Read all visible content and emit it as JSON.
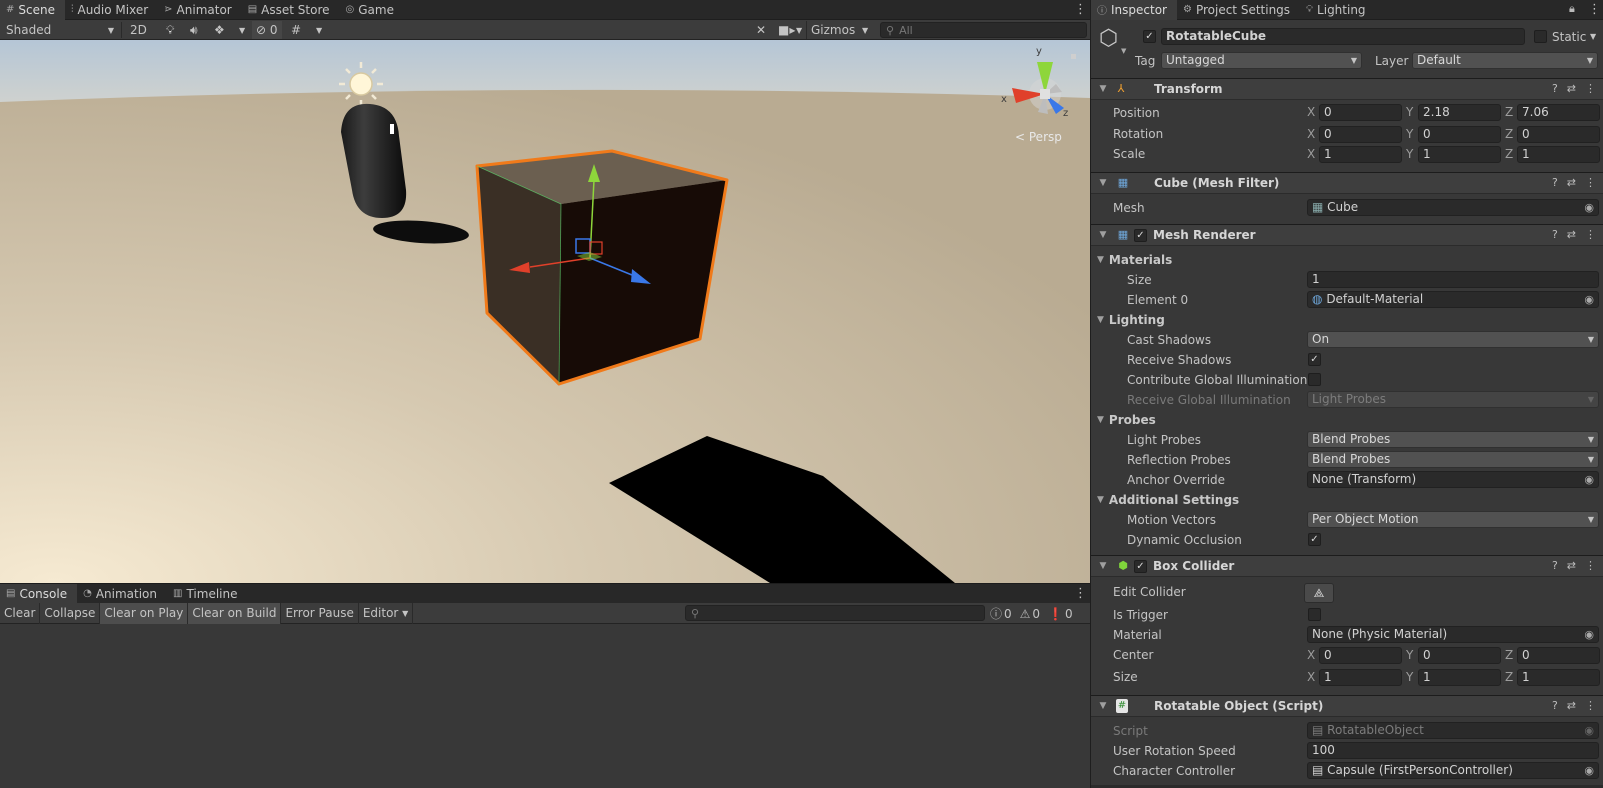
{
  "scene_window": {
    "tabs": [
      {
        "label": "Scene",
        "icon": "hash-icon"
      },
      {
        "label": "Audio Mixer",
        "icon": "mixer-icon"
      },
      {
        "label": "Animator",
        "icon": "animator-icon"
      },
      {
        "label": "Asset Store",
        "icon": "store-icon"
      },
      {
        "label": "Game",
        "icon": "gamepad-icon"
      }
    ],
    "toolbar": {
      "draw_mode": "Shaded",
      "mode_2d": "2D",
      "hidden_count": "0",
      "gizmos_label": "Gizmos",
      "search_placeholder": "All"
    },
    "persp_label": "Persp",
    "axis_labels": {
      "x": "x",
      "y": "y",
      "z": "z"
    }
  },
  "console_window": {
    "tabs": [
      {
        "label": "Console",
        "icon": "console-icon"
      },
      {
        "label": "Animation",
        "icon": "animation-icon"
      },
      {
        "label": "Timeline",
        "icon": "timeline-icon"
      }
    ],
    "buttons": [
      "Clear",
      "Collapse",
      "Clear on Play",
      "Clear on Build",
      "Error Pause",
      "Editor"
    ],
    "counts": {
      "info": "0",
      "warnings": "0",
      "errors": "0"
    }
  },
  "inspector": {
    "tabs": [
      "Inspector",
      "Project Settings",
      "Lighting"
    ],
    "object": {
      "name": "RotatableCube",
      "static_label": "Static",
      "tag_label": "Tag",
      "tag_value": "Untagged",
      "layer_label": "Layer",
      "layer_value": "Default"
    },
    "transform": {
      "title": "Transform",
      "position_label": "Position",
      "rotation_label": "Rotation",
      "scale_label": "Scale",
      "position": {
        "x": "0",
        "y": "2.18",
        "z": "7.06"
      },
      "rotation": {
        "x": "0",
        "y": "0",
        "z": "0"
      },
      "scale": {
        "x": "1",
        "y": "1",
        "z": "1"
      },
      "axes": {
        "x": "X",
        "y": "Y",
        "z": "Z"
      }
    },
    "mesh_filter": {
      "title": "Cube (Mesh Filter)",
      "mesh_label": "Mesh",
      "mesh_value": "Cube"
    },
    "mesh_renderer": {
      "title": "Mesh Renderer",
      "materials_section": "Materials",
      "size_label": "Size",
      "size_value": "1",
      "element0_label": "Element 0",
      "element0_value": "Default-Material",
      "lighting_section": "Lighting",
      "cast_shadows_label": "Cast Shadows",
      "cast_shadows_value": "On",
      "receive_shadows_label": "Receive Shadows",
      "contribute_gi_label": "Contribute Global Illumination",
      "receive_gi_label": "Receive Global Illumination",
      "receive_gi_value": "Light Probes",
      "probes_section": "Probes",
      "light_probes_label": "Light Probes",
      "light_probes_value": "Blend Probes",
      "reflection_probes_label": "Reflection Probes",
      "reflection_probes_value": "Blend Probes",
      "anchor_override_label": "Anchor Override",
      "anchor_override_value": "None (Transform)",
      "additional_section": "Additional Settings",
      "motion_vectors_label": "Motion Vectors",
      "motion_vectors_value": "Per Object Motion",
      "dynamic_occlusion_label": "Dynamic Occlusion"
    },
    "box_collider": {
      "title": "Box Collider",
      "edit_collider_label": "Edit Collider",
      "is_trigger_label": "Is Trigger",
      "material_label": "Material",
      "material_value": "None (Physic Material)",
      "center_label": "Center",
      "size_label": "Size",
      "center": {
        "x": "0",
        "y": "0",
        "z": "0"
      },
      "size": {
        "x": "1",
        "y": "1",
        "z": "1"
      }
    },
    "script_component": {
      "title": "Rotatable Object (Script)",
      "script_label": "Script",
      "script_value": "RotatableObject",
      "speed_label": "User Rotation Speed",
      "speed_value": "100",
      "controller_label": "Character Controller",
      "controller_value": "Capsule (FirstPersonController)"
    }
  },
  "colors": {
    "selection_outline": "#f07a1a",
    "axis_x": "#e0402a",
    "axis_y": "#8ed63b",
    "axis_z": "#3a78e8",
    "panel_bg": "#383838"
  }
}
